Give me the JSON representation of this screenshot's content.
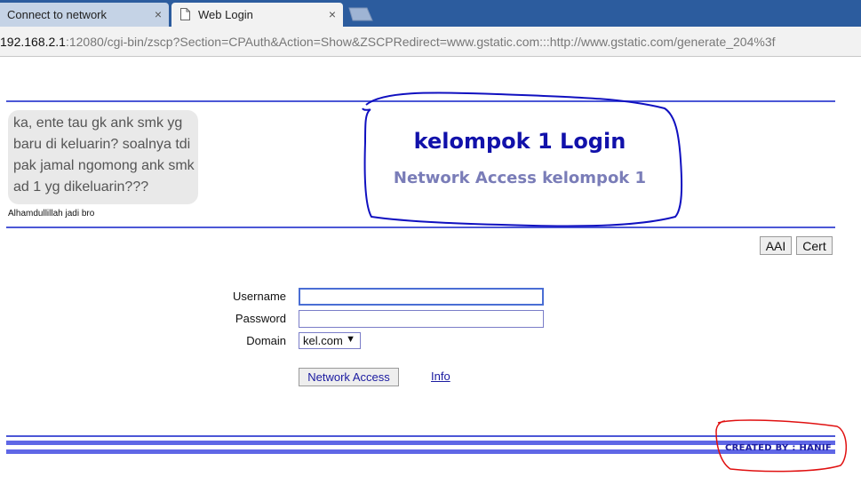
{
  "browser": {
    "tabs": [
      {
        "title": "Connect to network",
        "close": "×"
      },
      {
        "title": "Web Login",
        "close": "×"
      }
    ],
    "url_host": "192.168.2.1",
    "url_rest": ":12080/cgi-bin/zscp?Section=CPAuth&Action=Show&ZSCPRedirect=www.gstatic.com:::http://www.gstatic.com/generate_204%3f"
  },
  "meme": {
    "text": "ka, ente tau gk ank smk yg baru di keluarin? soalnya tdi pak jamal ngomong ank smk ad 1 yg dikeluarin???",
    "caption": "Alhamdullillah jadi bro"
  },
  "header": {
    "title": "kelompok 1 Login",
    "subtitle": "Network Access kelompok 1"
  },
  "top_buttons": {
    "aai": "AAI",
    "cert": "Cert"
  },
  "form": {
    "username_label": "Username",
    "password_label": "Password",
    "domain_label": "Domain",
    "username_value": "",
    "password_value": "",
    "domain_value": "kel.com",
    "submit_label": "Network Access",
    "info_label": "Info"
  },
  "footer": {
    "credit": "CREATED BY : HANIF"
  },
  "colors": {
    "accent": "#4c57d6",
    "title": "#1111aa",
    "annotation": "#e01010",
    "scribble": "#1010c0"
  }
}
